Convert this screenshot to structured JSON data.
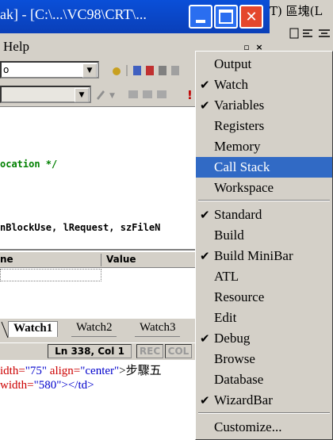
{
  "window": {
    "title": "ak] - [C:\\...\\VC98\\CRT\\...",
    "minimize_glyph": "",
    "close_glyph": "✕"
  },
  "other_window": {
    "ime_text": "T) 區塊(L"
  },
  "menubar": {
    "help_label": "Help",
    "mdi_min": "_",
    "mdi_restore": "▫",
    "mdi_close": "×"
  },
  "toolbar": {
    "combo1_value": "o",
    "combo_arrow": "▼"
  },
  "editor": {
    "line1": "ocation */",
    "line2": "  nBlockUse, lRequest, szFileN"
  },
  "watch": {
    "col_name": "ne",
    "col_value": "Value"
  },
  "tabs": [
    "Watch1",
    "Watch2",
    "Watch3"
  ],
  "status": {
    "position": "Ln 338, Col 1",
    "rec": "REC",
    "col": "COL"
  },
  "html_editor": {
    "line1_a": "idth=",
    "line1_b": "\"75\"",
    "line1_c": " align=",
    "line1_d": "\"center\"",
    "line1_e": ">步驟五",
    "line2_a": "width=",
    "line2_b": "\"580\"",
    "line2_c": "></td>"
  },
  "context_menu": {
    "items": [
      {
        "label": "Output",
        "checked": false
      },
      {
        "label": "Watch",
        "checked": true
      },
      {
        "label": "Variables",
        "checked": true
      },
      {
        "label": "Registers",
        "checked": false
      },
      {
        "label": "Memory",
        "checked": false
      },
      {
        "label": "Call Stack",
        "checked": false,
        "highlighted": true
      },
      {
        "label": "Workspace",
        "checked": false
      },
      {
        "label": "Standard",
        "checked": true
      },
      {
        "label": "Build",
        "checked": false
      },
      {
        "label": "Build MiniBar",
        "checked": true
      },
      {
        "label": "ATL",
        "checked": false
      },
      {
        "label": "Resource",
        "checked": false
      },
      {
        "label": "Edit",
        "checked": false
      },
      {
        "label": "Debug",
        "checked": true
      },
      {
        "label": "Browse",
        "checked": false
      },
      {
        "label": "Database",
        "checked": false
      },
      {
        "label": "WizardBar",
        "checked": true
      },
      {
        "label": "Customize...",
        "checked": false
      }
    ],
    "check_glyph": "✔"
  },
  "colors": {
    "titlebar": "#0a4fd8",
    "menu_highlight": "#316ac5",
    "close_button": "#e4472c",
    "code_comment": "#008000"
  }
}
